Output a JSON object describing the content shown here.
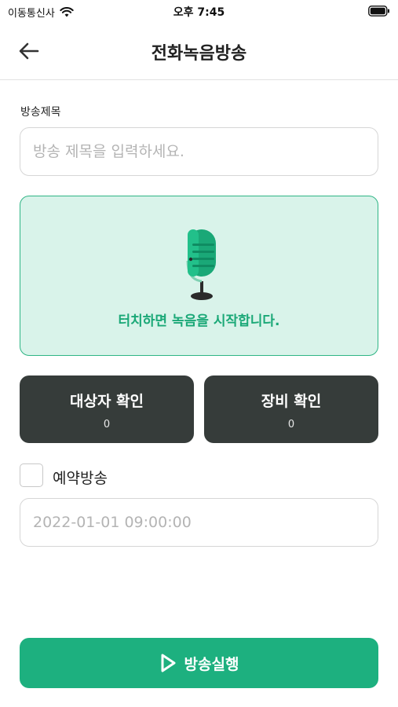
{
  "status_bar": {
    "carrier": "이동통신사",
    "time": "오후 7:45",
    "wifi_icon": "wifi-icon",
    "battery_icon": "battery-icon"
  },
  "header": {
    "title": "전화녹음방송",
    "back_icon": "arrow-left-icon"
  },
  "form": {
    "title_label": "방송제목",
    "title_placeholder": "방송 제목을 입력하세요.",
    "title_value": ""
  },
  "record": {
    "icon": "microphone-icon",
    "text": "터치하면 녹음을 시작합니다."
  },
  "cards": [
    {
      "label": "대상자 확인",
      "count": "0"
    },
    {
      "label": "장비 확인",
      "count": "0"
    }
  ],
  "reservation": {
    "checkbox_label": "예약방송",
    "checked": false,
    "date_placeholder": "2022-01-01 09:00:00"
  },
  "action": {
    "run_label": "방송실행",
    "run_icon": "play-icon"
  },
  "colors": {
    "accent": "#1db07f",
    "record_bg": "#d9f3ea",
    "card_bg": "#363c3a"
  }
}
